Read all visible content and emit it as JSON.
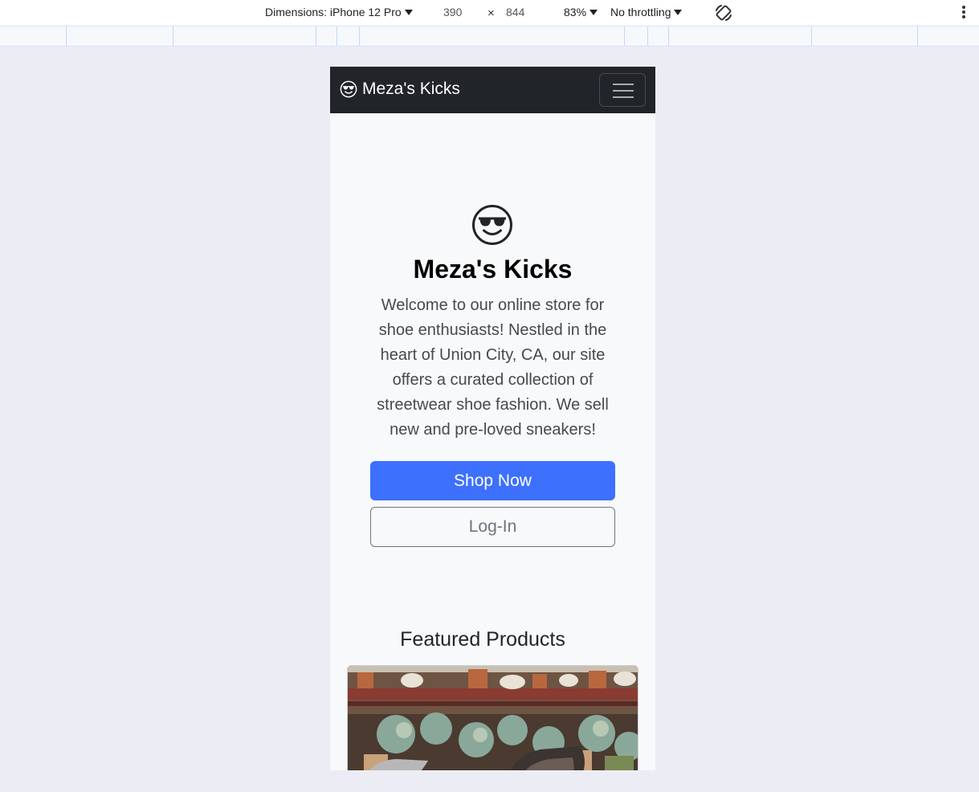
{
  "devtools": {
    "dimensions_label": "Dimensions: iPhone 12 Pro",
    "width": "390",
    "times": "×",
    "height": "844",
    "zoom": "83%",
    "throttling": "No throttling",
    "icons": [
      "caret-down-icon",
      "rotate-icon",
      "more-options-icon"
    ]
  },
  "navbar": {
    "brand": "Meza's Kicks",
    "brand_icon": "sunglasses-emoji-icon",
    "toggler_icon": "hamburger-menu-icon"
  },
  "hero": {
    "icon": "sunglasses-emoji-icon",
    "title": "Meza's Kicks",
    "text": "Welcome to our online store for shoe enthusiasts! Nestled in the heart of Union City, CA, our site offers a curated collection of streetwear shoe fashion. We sell new and pre-loved sneakers!",
    "shop_button": "Shop Now",
    "login_button": "Log-In"
  },
  "featured": {
    "title": "Featured Products"
  },
  "colors": {
    "navbar_bg": "#212529",
    "primary": "#3d70fd",
    "secondary": "#6c757d",
    "page_bg": "#f8f9fa",
    "viewport_bg": "#ecedf4"
  }
}
